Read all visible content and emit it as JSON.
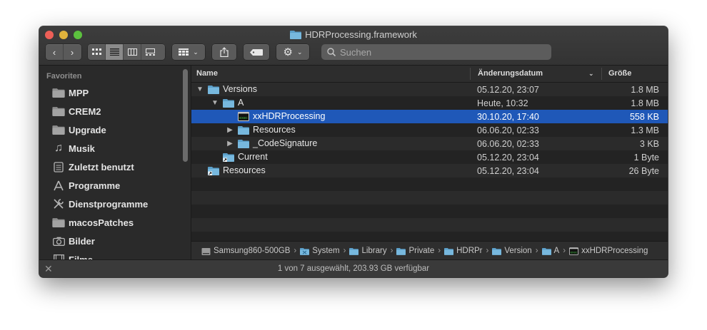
{
  "window": {
    "title": "HDRProcessing.framework"
  },
  "toolbar": {
    "back": "‹",
    "forward": "›",
    "view_modes": [
      "icons",
      "list",
      "columns",
      "gallery"
    ],
    "active_view": 1,
    "search_placeholder": "Suchen"
  },
  "sidebar": {
    "heading": "Favoriten",
    "items": [
      {
        "label": "MPP",
        "icon": "folder-icon"
      },
      {
        "label": "CREM2",
        "icon": "folder-icon"
      },
      {
        "label": "Upgrade",
        "icon": "folder-icon"
      },
      {
        "label": "Musik",
        "icon": "music-note-icon"
      },
      {
        "label": "Zuletzt benutzt",
        "icon": "recents-icon"
      },
      {
        "label": "Programme",
        "icon": "applications-icon"
      },
      {
        "label": "Dienstprogramme",
        "icon": "tools-icon"
      },
      {
        "label": "macosPatches",
        "icon": "folder-icon"
      },
      {
        "label": "Bilder",
        "icon": "camera-icon"
      },
      {
        "label": "Filme",
        "icon": "film-icon"
      }
    ]
  },
  "columns": {
    "name": "Name",
    "date": "Änderungsdatum",
    "size": "Größe"
  },
  "files": [
    {
      "name": "Versions",
      "date": "05.12.20, 23:07",
      "size": "1.8 MB",
      "depth": 0,
      "disclosure": "open",
      "kind": "folder"
    },
    {
      "name": "A",
      "date": "Heute, 10:32",
      "size": "1.8 MB",
      "depth": 1,
      "disclosure": "open",
      "kind": "folder"
    },
    {
      "name": "xxHDRProcessing",
      "date": "30.10.20, 17:40",
      "size": "558 KB",
      "depth": 2,
      "disclosure": "none",
      "kind": "exec",
      "selected": true
    },
    {
      "name": "Resources",
      "date": "06.06.20, 02:33",
      "size": "1.3 MB",
      "depth": 2,
      "disclosure": "closed",
      "kind": "folder"
    },
    {
      "name": "_CodeSignature",
      "date": "06.06.20, 02:33",
      "size": "3 KB",
      "depth": 2,
      "disclosure": "closed",
      "kind": "folder"
    },
    {
      "name": "Current",
      "date": "05.12.20, 23:04",
      "size": "1 Byte",
      "depth": 1,
      "disclosure": "none",
      "kind": "alias"
    },
    {
      "name": "Resources",
      "date": "05.12.20, 23:04",
      "size": "26 Byte",
      "depth": 0,
      "disclosure": "none",
      "kind": "alias"
    }
  ],
  "pathbar": [
    {
      "label": "Samsung860-500GB",
      "icon": "disk-icon"
    },
    {
      "label": "System",
      "icon": "system-folder-icon"
    },
    {
      "label": "Library",
      "icon": "folder-icon"
    },
    {
      "label": "Private",
      "icon": "folder-icon"
    },
    {
      "label": "HDRPr",
      "icon": "folder-icon"
    },
    {
      "label": "Version",
      "icon": "folder-icon"
    },
    {
      "label": "A",
      "icon": "folder-icon"
    },
    {
      "label": "xxHDRProcessing",
      "icon": "exec-icon"
    }
  ],
  "status": {
    "text": "1 von 7 ausgewählt, 203.93 GB verfügbar"
  },
  "colors": {
    "selection": "#1f58b8",
    "folder": "#6aaed6"
  }
}
